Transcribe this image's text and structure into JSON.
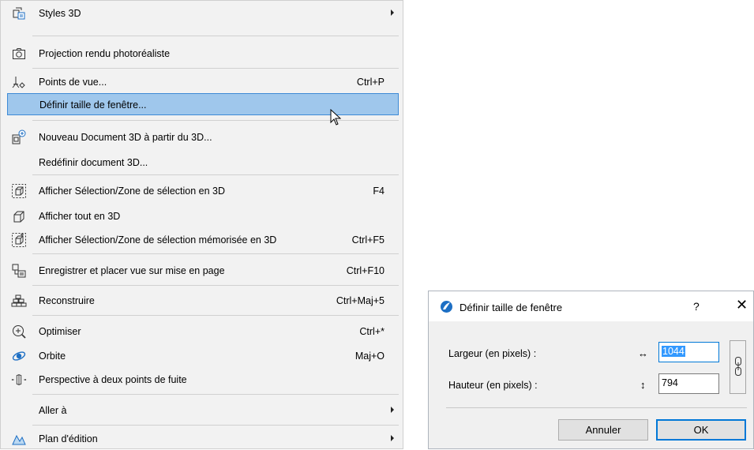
{
  "menu": {
    "items": [
      {
        "label": "Styles 3D",
        "shortcut": "",
        "icon": "styles-3d-icon"
      },
      {
        "label": "Projection rendu photoréaliste",
        "shortcut": "",
        "icon": "camera-icon"
      },
      {
        "label": "Points de vue...",
        "shortcut": "Ctrl+P",
        "icon": "viewpoints-icon"
      },
      {
        "label": "Définir taille de fenêtre...",
        "shortcut": "",
        "icon": ""
      },
      {
        "label": "Nouveau Document 3D à partir du 3D...",
        "shortcut": "",
        "icon": "new-3d-document-icon"
      },
      {
        "label": "Redéfinir document 3D...",
        "shortcut": "",
        "icon": ""
      },
      {
        "label": "Afficher Sélection/Zone de sélection en 3D",
        "shortcut": "F4",
        "icon": "show-selection-3d-icon"
      },
      {
        "label": "Afficher tout en 3D",
        "shortcut": "",
        "icon": "show-all-3d-icon"
      },
      {
        "label": "Afficher Sélection/Zone de sélection mémorisée en 3D",
        "shortcut": "Ctrl+F5",
        "icon": "show-stored-selection-3d-icon"
      },
      {
        "label": "Enregistrer et placer vue sur mise en page",
        "shortcut": "Ctrl+F10",
        "icon": "save-place-view-icon"
      },
      {
        "label": "Reconstruire",
        "shortcut": "Ctrl+Maj+5",
        "icon": "rebuild-icon"
      },
      {
        "label": "Optimiser",
        "shortcut": "Ctrl+*",
        "icon": "optimize-icon"
      },
      {
        "label": "Orbite",
        "shortcut": "Maj+O",
        "icon": "orbit-icon"
      },
      {
        "label": "Perspective à deux points de fuite",
        "shortcut": "",
        "icon": "two-point-perspective-icon"
      },
      {
        "label": "Aller à",
        "shortcut": "",
        "icon": ""
      },
      {
        "label": "Plan d'édition",
        "shortcut": "",
        "icon": "editing-plane-icon"
      }
    ]
  },
  "dialog": {
    "title": "Définir taille de fenêtre",
    "help": "?",
    "close": "✕",
    "width_label": "Largeur (en pixels) :",
    "width_arrow": "↔",
    "width_value": "1044",
    "height_label": "Hauteur (en pixels) :",
    "height_arrow": "↕",
    "height_value": "794",
    "cancel": "Annuler",
    "ok": "OK"
  },
  "colors": {
    "highlight": "#9fc7ec",
    "highlight_border": "#3d8ad6",
    "selection": "#3399ff"
  }
}
